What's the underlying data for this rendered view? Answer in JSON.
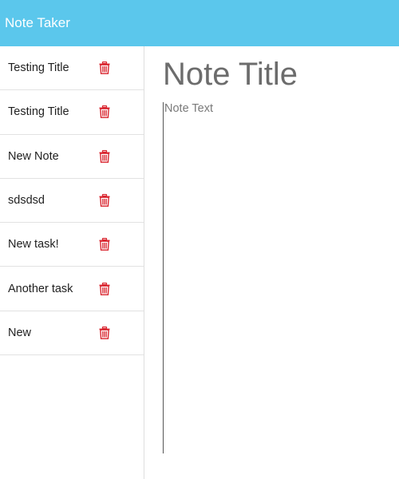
{
  "navbar": {
    "brand": "Note Taker"
  },
  "notes": [
    {
      "title": "Testing Title"
    },
    {
      "title": "Testing Title"
    },
    {
      "title": "New Note"
    },
    {
      "title": "sdsdsd"
    },
    {
      "title": "New task!"
    },
    {
      "title": "Another task"
    },
    {
      "title": "New"
    }
  ],
  "editor": {
    "title_placeholder": "Note Title",
    "text_placeholder": "Note Text"
  },
  "colors": {
    "navbar": "#5bc7ec",
    "delete_icon": "#d9252f"
  },
  "icons": {
    "delete": "trash-icon"
  }
}
